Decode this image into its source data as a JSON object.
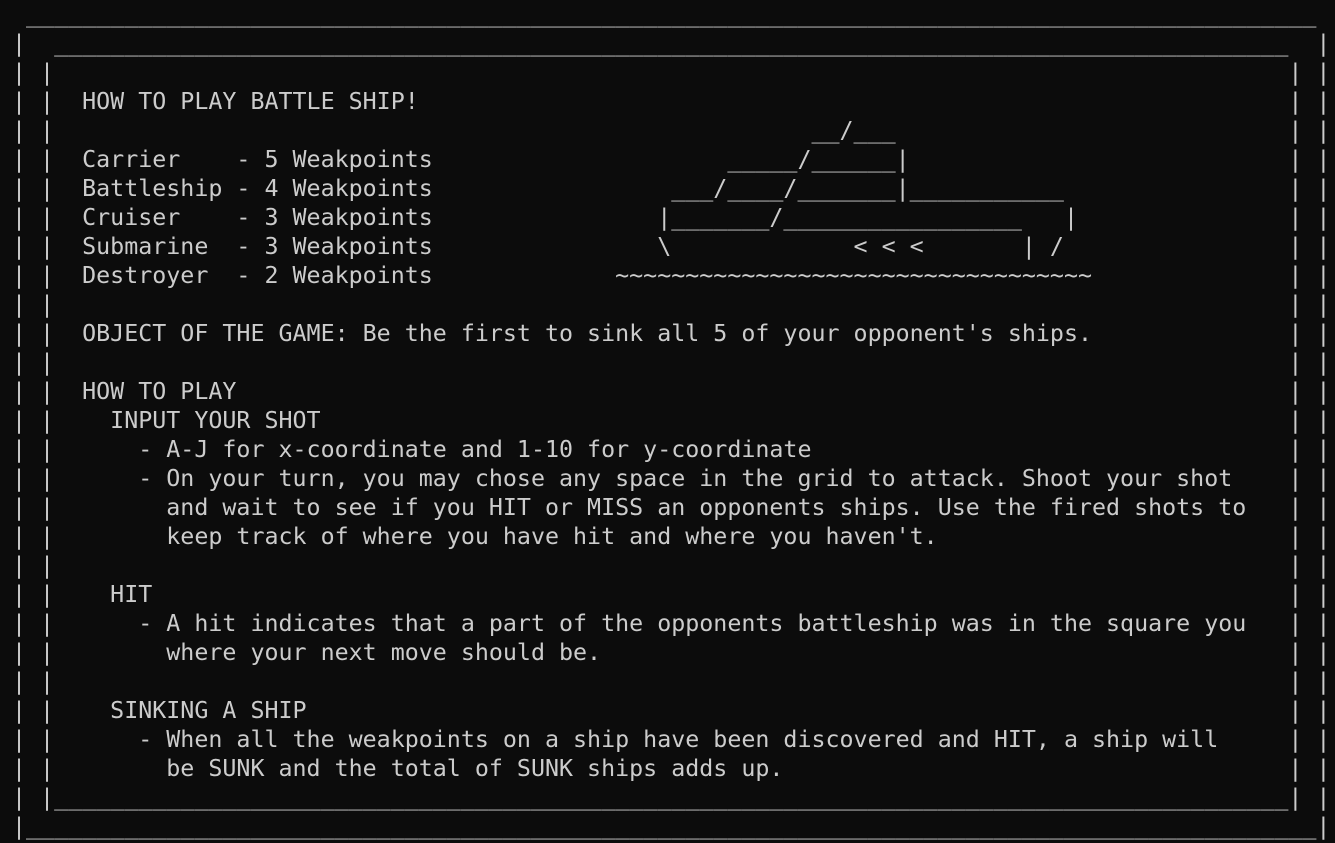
{
  "terminal": {
    "lines": [
      " ____________________________________________________________________________________________",
      "|  ________________________________________________________________________________________  |",
      "| |                                                                                        | |",
      "| |  HOW TO PLAY BATTLE SHIP!                                                              | |",
      "| |                                                      __/___                            | |",
      "| |  Carrier    - 5 Weakpoints                     _____/______|                           | |",
      "| |  Battleship - 4 Weakpoints                 ___/____/_______|___________                | |",
      "| |  Cruiser    - 3 Weakpoints                |_______/_________________   |               | |",
      "| |  Submarine  - 3 Weakpoints                \\             < < <       | /                | |",
      "| |  Destroyer  - 2 Weakpoints             ~~~~~~~~~~~~~~~~~~~~~~~~~~~~~~~~~~              | |",
      "| |                                                                                        | |",
      "| |  OBJECT OF THE GAME: Be the first to sink all 5 of your opponent's ships.              | |",
      "| |                                                                                        | |",
      "| |  HOW TO PLAY                                                                           | |",
      "| |    INPUT YOUR SHOT                                                                     | |",
      "| |      - A-J for x-coordinate and 1-10 for y-coordinate                                  | |",
      "| |      - On your turn, you may chose any space in the grid to attack. Shoot your shot    | |",
      "| |        and wait to see if you HIT or MISS an opponents ships. Use the fired shots to   | |",
      "| |        keep track of where you have hit and where you haven't.                         | |",
      "| |                                                                                        | |",
      "| |    HIT                                                                                 | |",
      "| |      - A hit indicates that a part of the opponents battleship was in the square you   | |",
      "| |        where your next move should be.                                                 | |",
      "| |                                                                                        | |",
      "| |    SINKING A SHIP                                                                      | |",
      "| |      - When all the weakpoints on a ship have been discovered and HIT, a ship will     | |",
      "| |        be SUNK and the total of SUNK ships adds up.                                    | |",
      "| |________________________________________________________________________________________| |",
      "|____________________________________________________________________________________________|"
    ]
  }
}
